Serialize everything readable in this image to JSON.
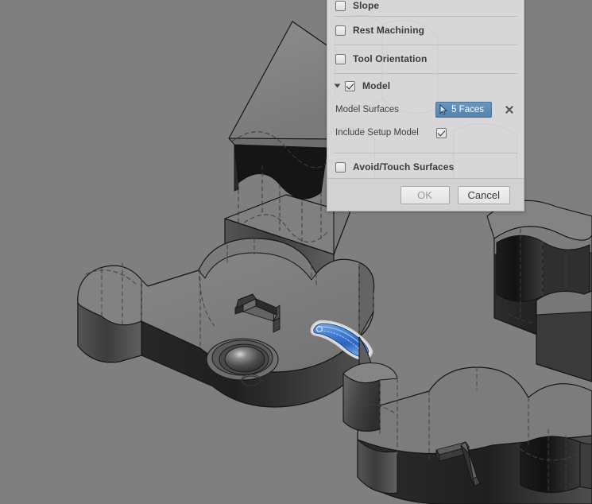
{
  "app": {
    "background_color": "#7f7f7f",
    "viewport_name": "cad-3d-viewport"
  },
  "dialog": {
    "background_color": "#d7d7d7",
    "sections": [
      {
        "id": "slope",
        "label": "Slope",
        "checked": false,
        "expanded": false,
        "partial": true
      },
      {
        "id": "rest-machining",
        "label": "Rest Machining",
        "checked": false,
        "expanded": false
      },
      {
        "id": "tool-orientation",
        "label": "Tool Orientation",
        "checked": false,
        "expanded": false
      },
      {
        "id": "model",
        "label": "Model",
        "checked": true,
        "expanded": true
      },
      {
        "id": "avoid-touch",
        "label": "Avoid/Touch Surfaces",
        "checked": false,
        "expanded": false
      }
    ],
    "model_group": {
      "model_surfaces": {
        "label": "Model Surfaces",
        "selection_value": "5 Faces",
        "selection_color": "#5382ae",
        "cursor_icon": "cursor-arrow-icon",
        "clear_icon": "close-x-icon"
      },
      "include_setup_model": {
        "label": "Include Setup Model",
        "checked": true
      }
    },
    "footer": {
      "ok_label": "OK",
      "ok_enabled": false,
      "cancel_label": "Cancel"
    }
  },
  "model": {
    "highlight_color": "#2f6fd0",
    "highlight_outline_color": "#e8e8e8",
    "face_light": "#848484",
    "face_mid": "#6f6f6f",
    "face_dark": "#3a3a3a",
    "face_darker": "#262626",
    "edge_color": "#1a1a1a",
    "hidden_edge_color": "#4a4a4a"
  }
}
